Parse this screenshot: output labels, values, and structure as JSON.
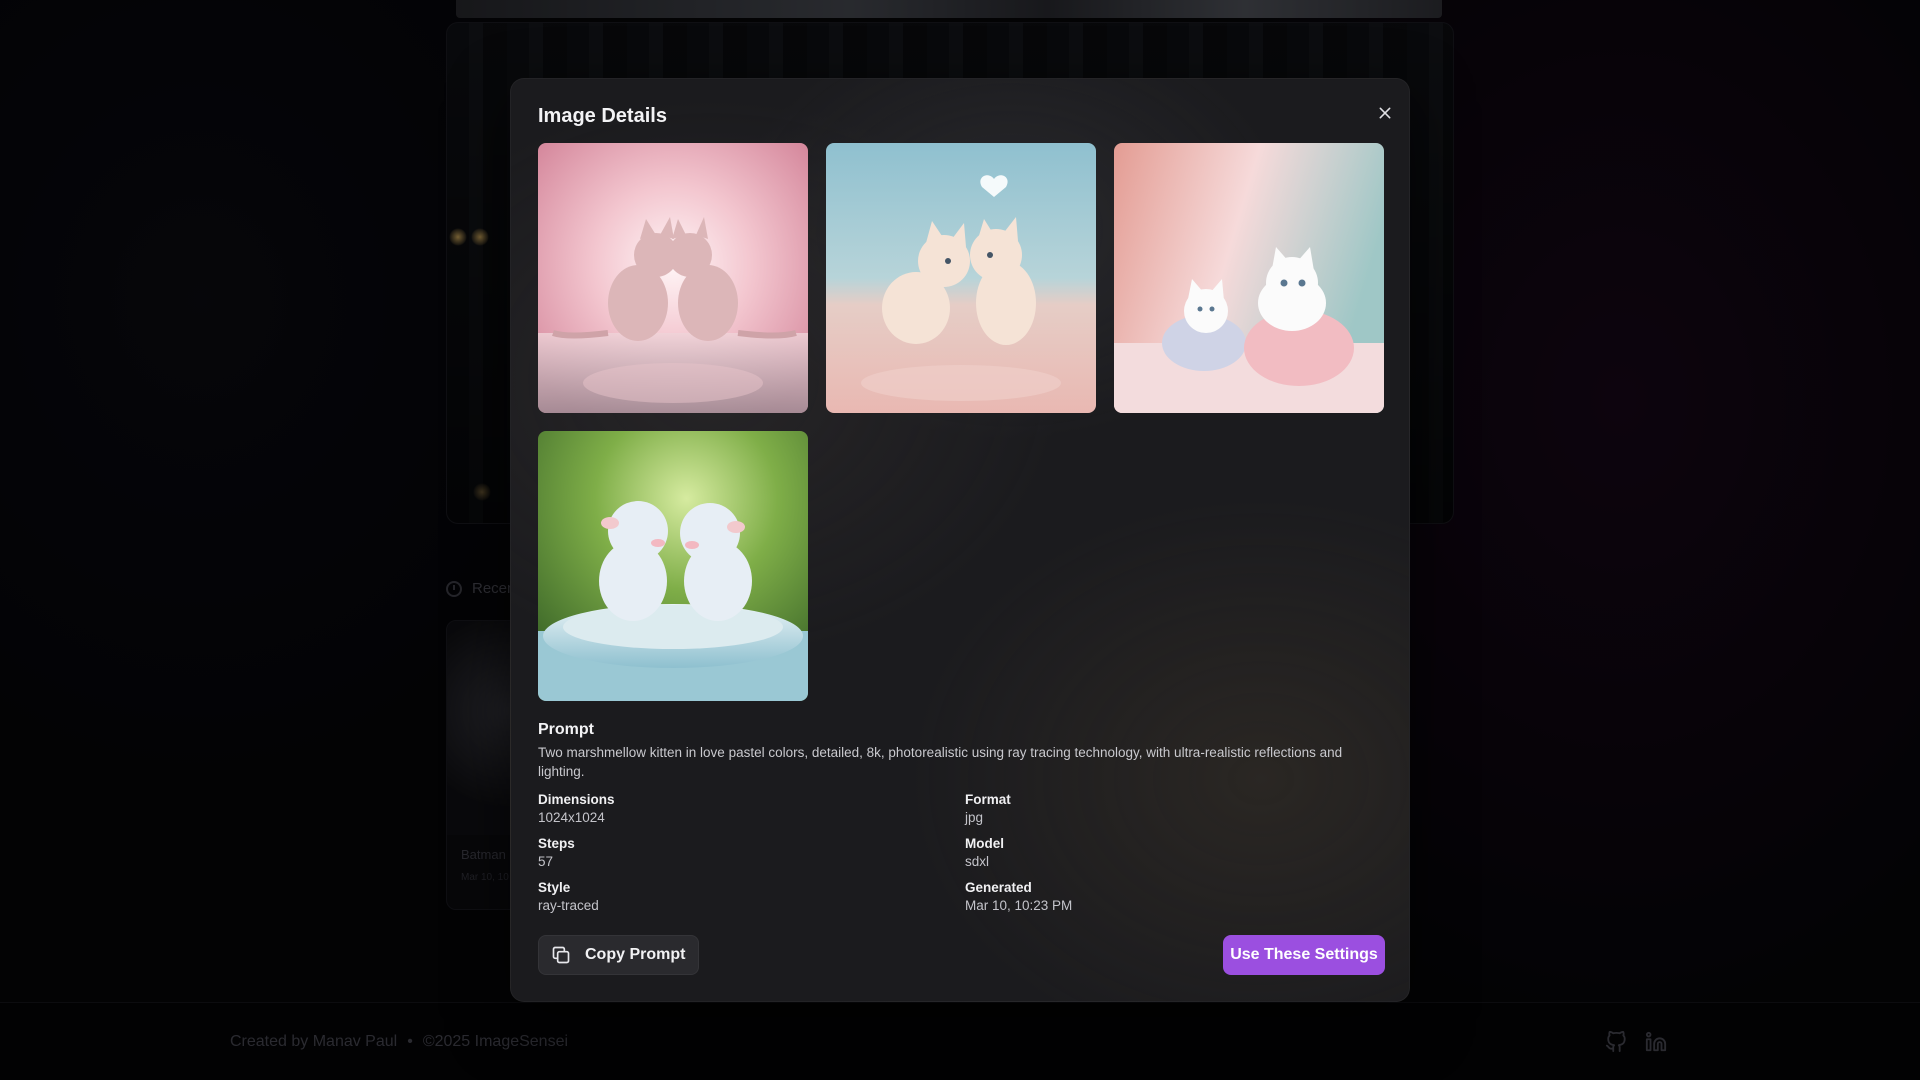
{
  "modal": {
    "title": "Image Details",
    "close_icon": "close-icon",
    "images": [
      {
        "alt_icon": "generated-image",
        "palette": [
          "#f3c7cf",
          "#e9a5b6",
          "#d7b9c0"
        ]
      },
      {
        "alt_icon": "generated-image",
        "palette": [
          "#9cc7d3",
          "#e7cfc9",
          "#f4e3dc"
        ]
      },
      {
        "alt_icon": "generated-image",
        "palette": [
          "#e6b0a6",
          "#f4d7d8",
          "#b5cfd0"
        ]
      },
      {
        "alt_icon": "generated-image",
        "palette": [
          "#7fae48",
          "#bfe0e8",
          "#e9d9dc"
        ]
      }
    ],
    "prompt_label": "Prompt",
    "prompt_text": "Two marshmellow kitten in love pastel colors, detailed, 8k, photorealistic using ray tracing technology, with ultra-realistic reflections and lighting.",
    "meta": [
      {
        "label": "Dimensions",
        "value": "1024x1024"
      },
      {
        "label": "Format",
        "value": "jpg"
      },
      {
        "label": "Steps",
        "value": "57"
      },
      {
        "label": "Model",
        "value": "sdxl"
      },
      {
        "label": "Style",
        "value": "ray-traced"
      },
      {
        "label": "Generated",
        "value": "Mar 10, 10:23 PM"
      }
    ],
    "copy_button": {
      "label": "Copy Prompt",
      "icon": "copy-icon"
    },
    "use_button": {
      "label": "Use These Settings"
    }
  },
  "background": {
    "recent_label": "Recen",
    "card_title": "Batman",
    "card_date": "Mar 10, 10"
  },
  "footer": {
    "credit": "Created by Manav Paul",
    "separator": "•",
    "copyright": "©2025 ImageSensei",
    "icons": [
      "github-icon",
      "linkedin-icon"
    ]
  },
  "colors": {
    "accent": "#9b4fe0",
    "modal_bg": "#1b1b1e",
    "page_bg": "#050508"
  }
}
